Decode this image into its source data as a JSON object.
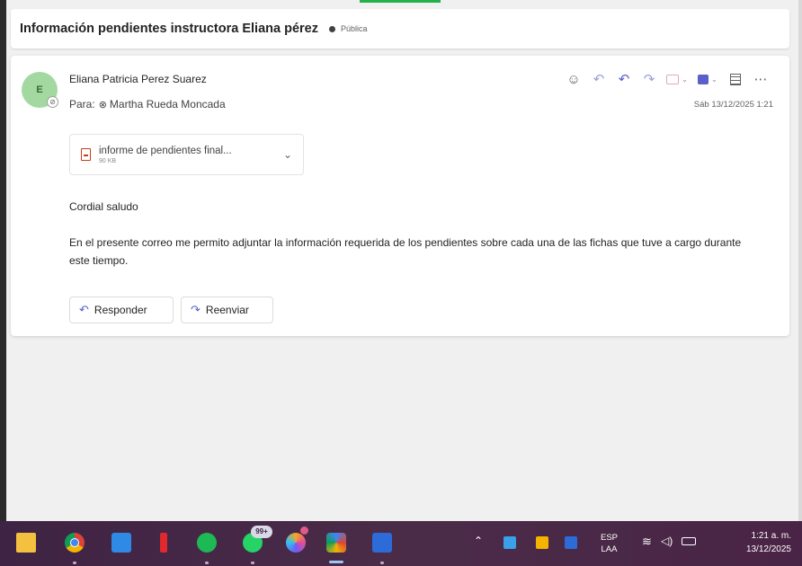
{
  "subject": "Información pendientes instructora Eliana pérez",
  "sensitivity_label": "Pública",
  "message": {
    "avatar_initial": "E",
    "sender": "Eliana Patricia Perez Suarez",
    "to_prefix": "Para:",
    "recipient": "Martha Rueda Moncada",
    "timestamp": "Sáb 13/12/2025 1:21",
    "attachment": {
      "name": "informe de pendientes final...",
      "size": "90 KB"
    },
    "greeting": "Cordial saludo",
    "body": "En el presente correo me permito adjuntar la información requerida de los pendientes sobre cada una de las fichas que tuve a cargo durante este tiempo."
  },
  "actions": {
    "reply_label": "Responder",
    "forward_label": "Reenviar"
  },
  "toolbar_icons": [
    "emoji-icon",
    "reply-icon",
    "reply-all-icon",
    "forward-icon",
    "apps-icon",
    "teams-icon",
    "immersive-reader-icon",
    "more-icon"
  ],
  "taskbar": {
    "whatsapp_badge": "99+",
    "lang_top": "ESP",
    "lang_bottom": "LAA",
    "time": "1:21 a. m.",
    "date": "13/12/2025"
  },
  "colors": {
    "accent": "#5b5fc7",
    "avatar_bg": "#a3d9a0",
    "taskbar": "#4a2c48"
  }
}
